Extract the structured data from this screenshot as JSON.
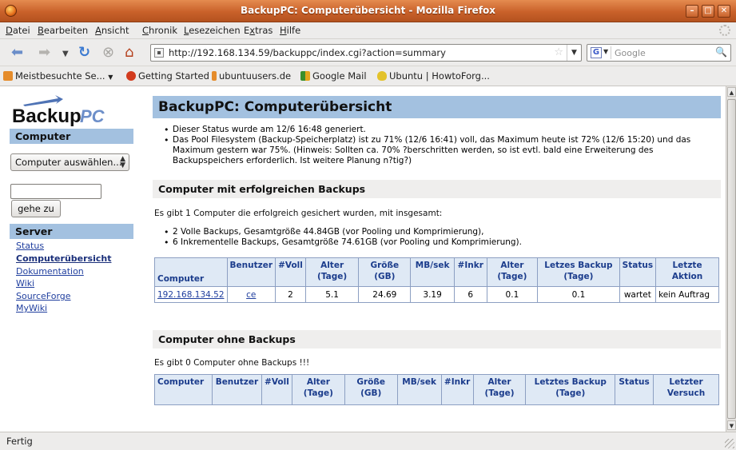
{
  "window": {
    "title": "BackupPC: Computerübersicht - Mozilla Firefox",
    "controls": {
      "minimize": "–",
      "maximize": "□",
      "close": "✕"
    }
  },
  "menu": {
    "items": [
      {
        "label": "Datei",
        "accel": "D",
        "rest": "atei"
      },
      {
        "label": "Bearbeiten",
        "accel": "B",
        "rest": "earbeiten"
      },
      {
        "label": "Ansicht",
        "accel": "A",
        "rest": "nsicht"
      },
      {
        "label": "Chronik",
        "accel": "C",
        "rest": "hronik"
      },
      {
        "label": "Lesezeichen",
        "accel": "L",
        "rest": "esezeichen"
      },
      {
        "label": "Extras",
        "pre": "E",
        "accel": "x",
        "rest": "tras"
      },
      {
        "label": "Hilfe",
        "accel": "H",
        "rest": "ilfe"
      }
    ]
  },
  "navbar": {
    "url": "http://192.168.134.59/backuppc/index.cgi?action=summary",
    "search_placeholder": "Google",
    "search_engine_glyph": "G"
  },
  "bookmarks": {
    "items": [
      {
        "label": "Meistbesuchte Se...",
        "dropdown": "▼",
        "icon_color": "#e58c2b"
      },
      {
        "label": "Getting Started",
        "icon_color": "#d23b1e"
      },
      {
        "label": "ubuntuusers.de",
        "icon_color": "#e58c2b"
      },
      {
        "label": "Google Mail",
        "icon_color": "#3a8f2b"
      },
      {
        "label": "Ubuntu | HowtoForg...",
        "icon_color": "#e3c22b"
      }
    ]
  },
  "sidebar": {
    "logo_text_a": "Backup",
    "logo_text_b": "PC",
    "computer_heading": "Computer",
    "host_select_value": "Computer auswählen...",
    "go_button": "gehe zu",
    "server_heading": "Server",
    "links": [
      {
        "label": "Status",
        "current": false
      },
      {
        "label": "Computerübersicht",
        "current": true
      },
      {
        "label": "Dokumentation",
        "current": false
      },
      {
        "label": "Wiki",
        "current": false
      },
      {
        "label": "SourceForge",
        "current": false
      },
      {
        "label": "MyWiki",
        "current": false
      }
    ]
  },
  "main": {
    "title": "BackupPC: Computerübersicht",
    "status_bullets": [
      "Dieser Status wurde am 12/6 16:48 generiert.",
      "Das Pool Filesystem (Backup-Speicherplatz) ist zu 71% (12/6 16:41) voll, das Maximum heute ist 72% (12/6 15:20) und das Maximum gestern war 75%. (Hinweis: Sollten ca. 70% ?berschritten werden, so ist evtl. bald eine Erweiterung des Backupspeichers erforderlich. Ist weitere Planung n?tig?)"
    ],
    "with_backups": {
      "heading": "Computer mit erfolgreichen Backups",
      "summary": "Es gibt 1 Computer die erfolgreich gesichert wurden, mit insgesamt:",
      "bullets": [
        "2 Volle Backups, Gesamtgröße 44.84GB (vor Pooling und Komprimierung),",
        "6 Inkrementelle Backups, Gesamtgröße 74.61GB (vor Pooling und Komprimierung)."
      ],
      "columns": [
        "Computer",
        "Benutzer",
        "#Voll",
        "Alter (Tage)",
        "Größe (GB)",
        "MB/sek",
        "#Inkr",
        "Alter (Tage)",
        "Letzes Backup (Tage)",
        "Status",
        "Letzte Aktion"
      ],
      "rows": [
        [
          "192.168.134.52",
          "ce",
          "2",
          "5.1",
          "24.69",
          "3.19",
          "6",
          "0.1",
          "0.1",
          "wartet",
          "kein Auftrag"
        ]
      ]
    },
    "without_backups": {
      "heading": "Computer ohne Backups",
      "summary": "Es gibt 0 Computer ohne Backups !!!",
      "columns": [
        "Computer",
        "Benutzer",
        "#Voll",
        "Alter (Tage)",
        "Größe (GB)",
        "MB/sek",
        "#Inkr",
        "Alter (Tage)",
        "Letztes Backup (Tage)",
        "Status",
        "Letzter Versuch"
      ]
    }
  },
  "statusbar": {
    "text": "Fertig"
  }
}
